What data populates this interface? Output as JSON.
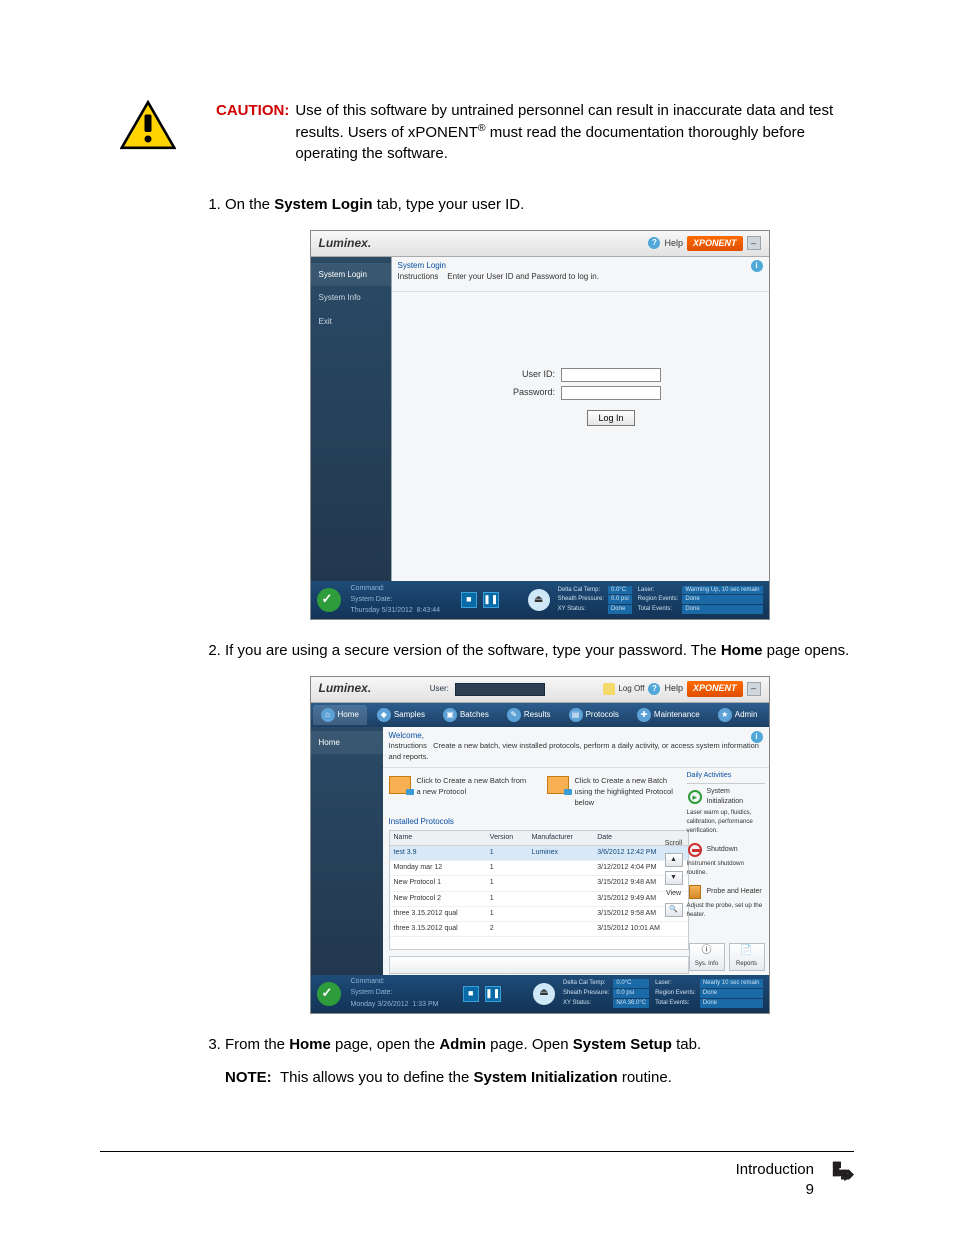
{
  "caution": {
    "label": "CAUTION:",
    "text_before": "Use of this software by untrained personnel can result in inaccurate data and test results. Users of xPONENT",
    "sup": "®",
    "text_after": " must read the documentation thoroughly before operating the software."
  },
  "steps": {
    "s1_a": "On the ",
    "s1_b": "System Login",
    "s1_c": " tab, type your user ID.",
    "s2_a": "If you are using a secure version of the software, type your password. The ",
    "s2_b": "Home",
    "s2_c": " page opens.",
    "s3_a": "From the ",
    "s3_b": "Home",
    "s3_c": " page, open the ",
    "s3_d": "Admin",
    "s3_e": " page. Open ",
    "s3_f": "System Setup",
    "s3_g": " tab."
  },
  "note": {
    "label": "NOTE:",
    "a": "This allows you to define the ",
    "b": "System Initialization",
    "c": " routine."
  },
  "login": {
    "brand": "Luminex.",
    "help": "Help",
    "xponent": "XPONENT",
    "sidetabs": {
      "login": "System Login",
      "info": "System Info",
      "exit": "Exit"
    },
    "instr_title": "System Login",
    "instr_label": "Instructions",
    "instr_text": "Enter your User ID and Password to log in.",
    "user_label": "User ID:",
    "pass_label": "Password:",
    "button": "Log In",
    "footer": {
      "connect": "Connect",
      "command": "Command:",
      "sysdate": "System Date:",
      "date": "Thursday 5/31/2012",
      "time": "8:43:44",
      "eject": "Eject",
      "delta": "Delta Cal Temp:",
      "delta_v": "0.0°C",
      "sheath": "Sheath Pressure:",
      "sheath_v": "0.0 psi",
      "xy": "XY Status:",
      "xy_v": "Done",
      "laser": "Laser:",
      "laser_v": "Warming Up, 10 sec remain",
      "regione": "Region Events:",
      "regione_v": "Done",
      "total": "Total Events:",
      "total_v": "Done"
    }
  },
  "home": {
    "brand": "Luminex.",
    "user_label": "User:",
    "logoff": "Log Off",
    "help": "Help",
    "xponent": "XPONENT",
    "nav": {
      "home": "Home",
      "samples": "Samples",
      "batches": "Batches",
      "results": "Results",
      "protocols": "Protocols",
      "maintenance": "Maintenance",
      "admin": "Admin"
    },
    "side_home": "Home",
    "welcome": "Welcome,",
    "instr_label": "Instructions",
    "instr_text": "Create a new batch, view installed protocols, perform a daily activity, or access system information and reports.",
    "create_batch_new": "Click to Create a new Batch from a new Protocol",
    "create_batch_hi": "Click to Create a new Batch using the highlighted Protocol below",
    "installed_title": "Installed Protocols",
    "table": {
      "headers": {
        "name": "Name",
        "version": "Version",
        "mfr": "Manufacturer",
        "date": "Date"
      },
      "rows": [
        {
          "name": "test 3.9",
          "version": "1",
          "mfr": "Luminex",
          "date": "3/6/2012 12:42 PM"
        },
        {
          "name": "Monday mar 12",
          "version": "1",
          "mfr": "",
          "date": "3/12/2012 4:04 PM"
        },
        {
          "name": "New Protocol 1",
          "version": "1",
          "mfr": "",
          "date": "3/15/2012 9:48 AM"
        },
        {
          "name": "New Protocol 2",
          "version": "1",
          "mfr": "",
          "date": "3/15/2012 9:49 AM"
        },
        {
          "name": "three 3.15.2012 qual",
          "version": "1",
          "mfr": "",
          "date": "3/15/2012 9:58 AM"
        },
        {
          "name": "three 3.15.2012 qual",
          "version": "2",
          "mfr": "",
          "date": "3/15/2012 10:01 AM"
        }
      ]
    },
    "scroll": {
      "label": "Scroll",
      "view": "View"
    },
    "daily": {
      "title": "Daily Activities",
      "sysinit": "System Initialization",
      "sysinit_desc": "Laser warm up, fluidics, calibration, performance verification.",
      "shutdown": "Shutdown",
      "shutdown_desc": "Instrument shutdown routine.",
      "probe": "Probe and Heater",
      "probe_desc": "Adjust the probe, set up the heater."
    },
    "sysinfo_btn": "Sys. Info",
    "reports_btn": "Reports",
    "footer": {
      "connect": "Connect",
      "command": "Command:",
      "sysdate": "System Date:",
      "date": "Monday 3/26/2012",
      "time": "1:33 PM",
      "eject": "Eject",
      "delta": "Delta Cal Temp:",
      "delta_v": "0.0°C",
      "sheath": "Sheath Pressure:",
      "sheath_v": "0.0 psi",
      "xy": "XY Status:",
      "xy_v": "N/A  36.0°C",
      "laser": "Laser:",
      "laser_v": "Nearly 10 sec remain",
      "regione": "Region Events:",
      "regione_v": "Done",
      "total": "Total Events:",
      "total_v": "Done"
    }
  },
  "footer": {
    "section": "Introduction",
    "page": "9"
  }
}
